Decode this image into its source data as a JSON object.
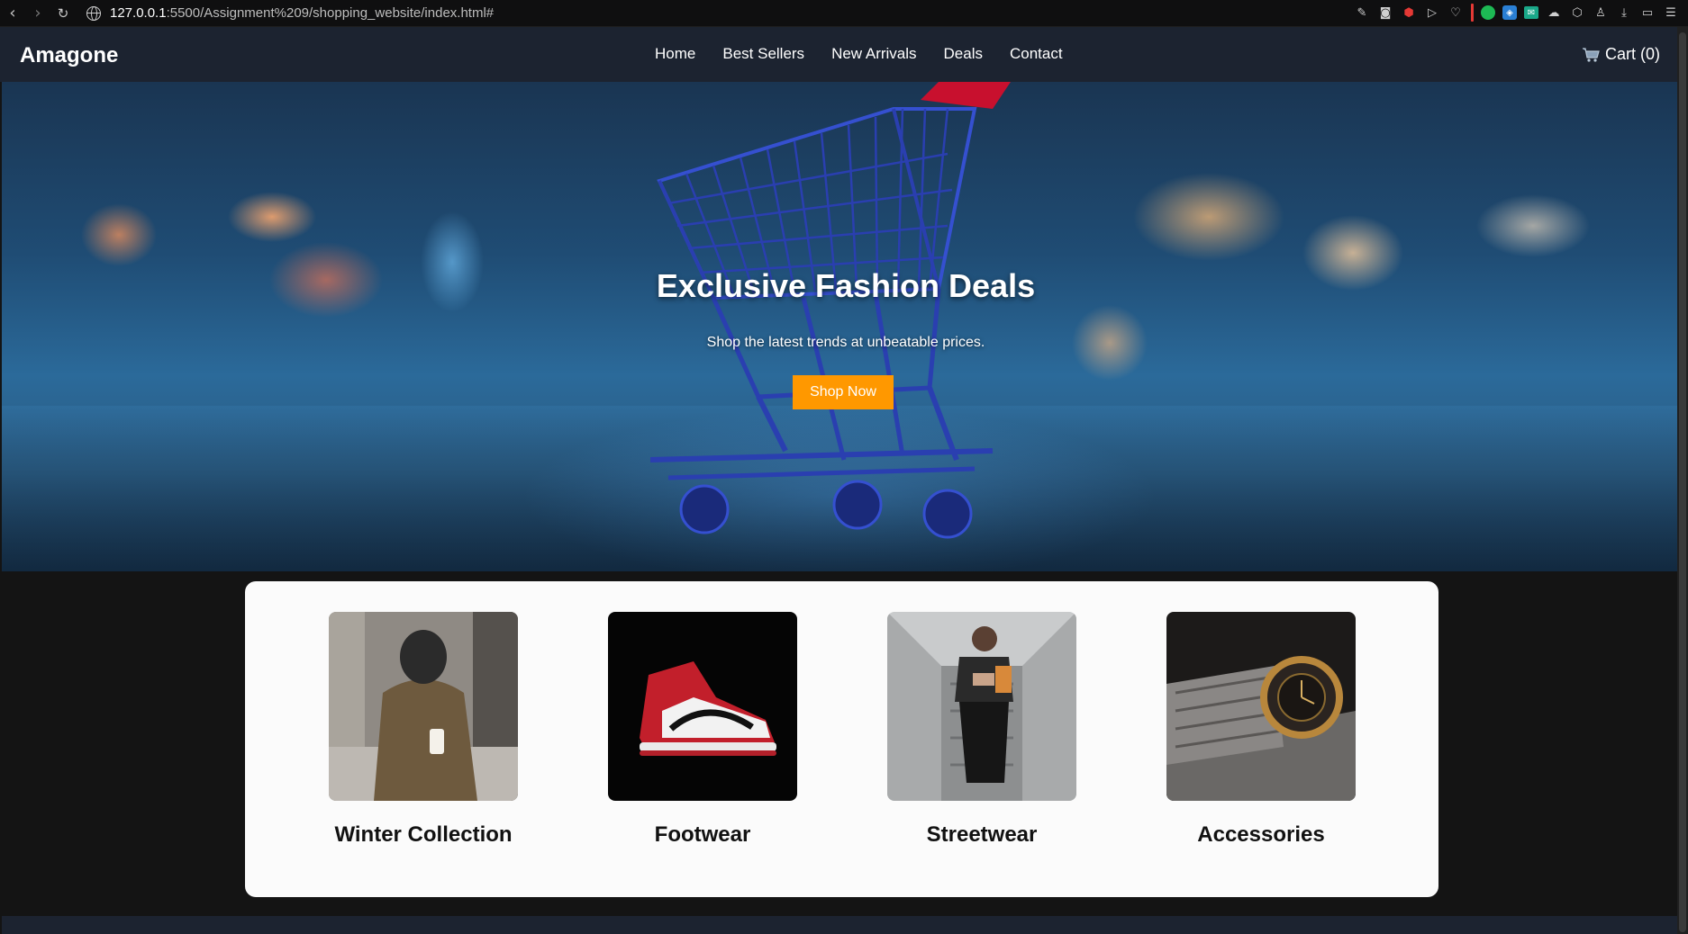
{
  "browser": {
    "url_host": "127.0.0.1",
    "url_path": ":5500/Assignment%209/shopping_website/index.html#"
  },
  "header": {
    "logo": "Amagone",
    "nav": [
      "Home",
      "Best Sellers",
      "New Arrivals",
      "Deals",
      "Contact"
    ],
    "cart_label": "Cart (0)"
  },
  "hero": {
    "title": "Exclusive Fashion Deals",
    "subtitle": "Shop the latest trends at unbeatable prices.",
    "cta": "Shop Now"
  },
  "categories": [
    {
      "label": "Winter Collection",
      "image": "man-in-winter-jacket-photo"
    },
    {
      "label": "Footwear",
      "image": "red-sneaker-photo"
    },
    {
      "label": "Streetwear",
      "image": "streetwear-model-photo"
    },
    {
      "label": "Accessories",
      "image": "wristwatch-photo"
    }
  ],
  "colors": {
    "header_bg": "#1c2330",
    "accent": "#ff9800",
    "page_bg": "#141414",
    "panel_bg": "#fbfbfb"
  }
}
